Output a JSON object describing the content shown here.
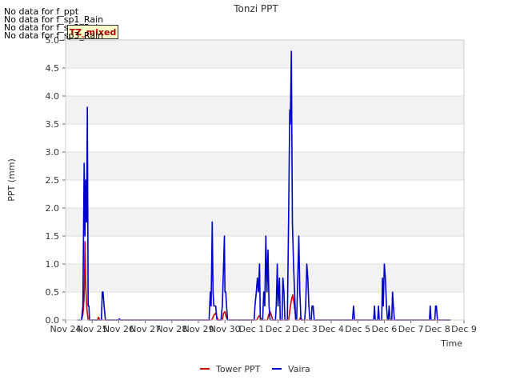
{
  "no_data_messages": [
    "No data for f_ppt",
    "No data for f_sp1_Rain",
    "No data for f_sp2_Rain",
    "No data for f_sp3_Rain"
  ],
  "badge_label": "TZ_mixed",
  "chart_data": {
    "type": "line",
    "title": "Tonzi PPT",
    "xlabel": "Time",
    "ylabel": "PPT (mm)",
    "ylim": [
      0,
      5
    ],
    "yticks": [
      0.0,
      0.5,
      1.0,
      1.5,
      2.0,
      2.5,
      3.0,
      3.5,
      4.0,
      4.5,
      5.0
    ],
    "ytick_labels": [
      "0.0",
      "0.5",
      "1.0",
      "1.5",
      "2.0",
      "2.5",
      "3.0",
      "3.5",
      "4.0",
      "4.5",
      "5.0"
    ],
    "xlim": [
      0,
      15
    ],
    "x_unit": "days since Nov 24",
    "xticks": [
      0,
      1,
      2,
      3,
      4,
      5,
      6,
      7,
      8,
      9,
      10,
      11,
      12,
      13,
      14,
      15
    ],
    "xtick_labels": [
      "Nov 24",
      "Nov 25",
      "Nov 26",
      "Nov 27",
      "Nov 28",
      "Nov 29",
      "Nov 30",
      "Dec 1",
      "Dec 2",
      "Dec 3",
      "Dec 4",
      "Dec 5",
      "Dec 6",
      "Dec 7",
      "Dec 8",
      "Dec 9"
    ],
    "grid": true,
    "band_fill": true,
    "legend_position": "bottom-center",
    "series": [
      {
        "name": "Tower PPT",
        "color": "#cc0000",
        "points": [
          [
            0.6,
            0
          ],
          [
            0.65,
            0.1
          ],
          [
            0.7,
            0.4
          ],
          [
            0.73,
            1.4
          ],
          [
            0.76,
            0.6
          ],
          [
            0.8,
            0.2
          ],
          [
            0.85,
            0
          ],
          [
            1.2,
            0
          ],
          [
            1.24,
            0.05
          ],
          [
            1.28,
            0
          ],
          [
            2.0,
            0
          ],
          [
            2.03,
            0.02
          ],
          [
            2.06,
            0
          ],
          [
            5.5,
            0
          ],
          [
            5.55,
            0.05
          ],
          [
            5.6,
            0.1
          ],
          [
            5.65,
            0.12
          ],
          [
            5.7,
            0.05
          ],
          [
            5.75,
            0
          ],
          [
            5.9,
            0
          ],
          [
            5.95,
            0.12
          ],
          [
            6.0,
            0.15
          ],
          [
            6.05,
            0.05
          ],
          [
            6.1,
            0
          ],
          [
            7.2,
            0
          ],
          [
            7.25,
            0.05
          ],
          [
            7.3,
            0.08
          ],
          [
            7.35,
            0.03
          ],
          [
            7.4,
            0
          ],
          [
            7.6,
            0
          ],
          [
            7.65,
            0.1
          ],
          [
            7.7,
            0.15
          ],
          [
            7.75,
            0.08
          ],
          [
            7.8,
            0
          ],
          [
            8.4,
            0
          ],
          [
            8.45,
            0.2
          ],
          [
            8.5,
            0.35
          ],
          [
            8.55,
            0.45
          ],
          [
            8.6,
            0.3
          ],
          [
            8.65,
            0.1
          ],
          [
            8.7,
            0
          ],
          [
            8.8,
            0
          ],
          [
            8.85,
            0.05
          ],
          [
            8.9,
            0
          ],
          [
            14.5,
            0
          ]
        ]
      },
      {
        "name": "Vaira",
        "color": "#0000cc",
        "points": [
          [
            0.45,
            0
          ],
          [
            0.6,
            0
          ],
          [
            0.65,
            0.25
          ],
          [
            0.7,
            2.8
          ],
          [
            0.73,
            1.5
          ],
          [
            0.76,
            2.5
          ],
          [
            0.79,
            1.75
          ],
          [
            0.82,
            3.8
          ],
          [
            0.85,
            0.25
          ],
          [
            0.88,
            0.25
          ],
          [
            0.9,
            0
          ],
          [
            1.35,
            0
          ],
          [
            1.38,
            0.5
          ],
          [
            1.41,
            0.5
          ],
          [
            1.45,
            0.25
          ],
          [
            1.5,
            0
          ],
          [
            2.0,
            0
          ],
          [
            2.02,
            0.02
          ],
          [
            2.05,
            0
          ],
          [
            5.4,
            0
          ],
          [
            5.45,
            0.5
          ],
          [
            5.48,
            0.25
          ],
          [
            5.52,
            1.75
          ],
          [
            5.55,
            0.5
          ],
          [
            5.58,
            0.25
          ],
          [
            5.62,
            0.25
          ],
          [
            5.65,
            0.25
          ],
          [
            5.7,
            0
          ],
          [
            5.85,
            0
          ],
          [
            5.9,
            0.25
          ],
          [
            5.95,
            1.0
          ],
          [
            5.98,
            1.5
          ],
          [
            6.0,
            0.5
          ],
          [
            6.03,
            0.5
          ],
          [
            6.06,
            0.25
          ],
          [
            6.1,
            0
          ],
          [
            7.1,
            0
          ],
          [
            7.13,
            0.25
          ],
          [
            7.18,
            0.5
          ],
          [
            7.22,
            0.75
          ],
          [
            7.26,
            0.5
          ],
          [
            7.3,
            1.0
          ],
          [
            7.33,
            0
          ],
          [
            7.42,
            0
          ],
          [
            7.46,
            0.5
          ],
          [
            7.5,
            0.25
          ],
          [
            7.54,
            1.5
          ],
          [
            7.58,
            0.5
          ],
          [
            7.62,
            1.25
          ],
          [
            7.66,
            0.25
          ],
          [
            7.7,
            0
          ],
          [
            7.9,
            0
          ],
          [
            7.93,
            0.25
          ],
          [
            7.97,
            1.0
          ],
          [
            8.0,
            0.25
          ],
          [
            8.05,
            0.75
          ],
          [
            8.08,
            0
          ],
          [
            8.15,
            0
          ],
          [
            8.18,
            0.75
          ],
          [
            8.22,
            0.5
          ],
          [
            8.26,
            0
          ],
          [
            8.35,
            0
          ],
          [
            8.4,
            2.0
          ],
          [
            8.44,
            3.75
          ],
          [
            8.46,
            3.5
          ],
          [
            8.5,
            4.8
          ],
          [
            8.54,
            1.75
          ],
          [
            8.58,
            1.0
          ],
          [
            8.62,
            0.5
          ],
          [
            8.66,
            0
          ],
          [
            8.7,
            0
          ],
          [
            8.74,
            0.75
          ],
          [
            8.78,
            1.5
          ],
          [
            8.82,
            0.5
          ],
          [
            8.86,
            0
          ],
          [
            9.0,
            0
          ],
          [
            9.04,
            0.25
          ],
          [
            9.08,
            1.0
          ],
          [
            9.12,
            0.75
          ],
          [
            9.16,
            0.25
          ],
          [
            9.2,
            0
          ],
          [
            9.25,
            0
          ],
          [
            9.28,
            0.25
          ],
          [
            9.32,
            0.25
          ],
          [
            9.36,
            0
          ],
          [
            10.8,
            0
          ],
          [
            10.84,
            0.25
          ],
          [
            10.88,
            0
          ],
          [
            11.6,
            0
          ],
          [
            11.63,
            0.25
          ],
          [
            11.66,
            0
          ],
          [
            11.75,
            0
          ],
          [
            11.78,
            0.25
          ],
          [
            11.81,
            0
          ],
          [
            11.9,
            0
          ],
          [
            11.93,
            0.75
          ],
          [
            11.96,
            0.25
          ],
          [
            12.0,
            1.0
          ],
          [
            12.04,
            0.75
          ],
          [
            12.08,
            0.25
          ],
          [
            12.12,
            0
          ],
          [
            12.15,
            0
          ],
          [
            12.18,
            0.25
          ],
          [
            12.22,
            0
          ],
          [
            12.28,
            0
          ],
          [
            12.31,
            0.5
          ],
          [
            12.34,
            0.25
          ],
          [
            12.38,
            0
          ],
          [
            13.7,
            0
          ],
          [
            13.73,
            0.25
          ],
          [
            13.76,
            0
          ],
          [
            13.9,
            0
          ],
          [
            13.93,
            0.25
          ],
          [
            13.96,
            0.25
          ],
          [
            14.0,
            0
          ],
          [
            14.5,
            0
          ]
        ]
      }
    ]
  }
}
